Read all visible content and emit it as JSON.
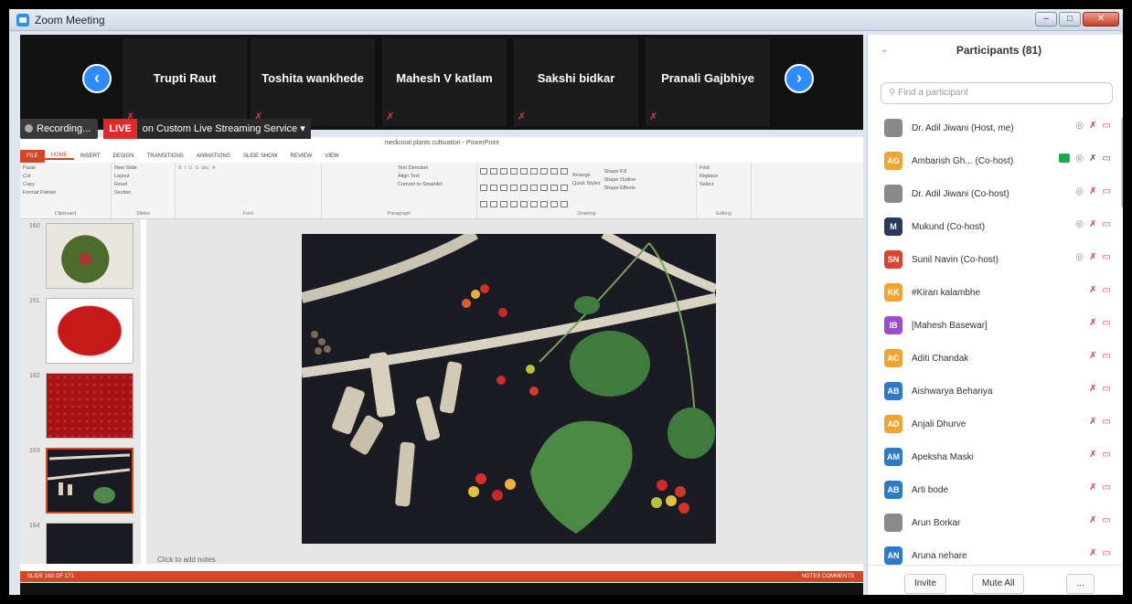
{
  "window": {
    "title": "Zoom Meeting",
    "min": "",
    "max": "",
    "close": ""
  },
  "strip": {
    "prev": "<",
    "next": ">",
    "participants": [
      "Trupti Raut",
      "Toshita wankhede",
      "Mahesh V katlam",
      "Sakshi bidkar",
      "Pranali Gajbhiye"
    ]
  },
  "recording": {
    "label": "Recording...",
    "live": "LIVE",
    "service": "on Custom Live Streaming Service"
  },
  "ppt": {
    "title": "medicinal plants cultivation - PowerPoint",
    "tabs": [
      "FILE",
      "HOME",
      "INSERT",
      "DESIGN",
      "TRANSITIONS",
      "ANIMATIONS",
      "SLIDE SHOW",
      "REVIEW",
      "VIEW"
    ],
    "ribbon": {
      "clipboard": {
        "paste": "Paste",
        "cut": "Cut",
        "copy": "Copy",
        "format": "Format Painter",
        "label": "Clipboard"
      },
      "slides": {
        "new": "New Slide",
        "layout": "Layout",
        "reset": "Reset",
        "section": "Section",
        "label": "Slides"
      },
      "font": {
        "label": "Font"
      },
      "paragraph": {
        "dir": "Text Direction",
        "align": "Align Text",
        "convert": "Convert to SmartArt",
        "label": "Paragraph"
      },
      "drawing": {
        "arrange": "Arrange",
        "quick": "Quick Styles",
        "fill": "Shape Fill",
        "outline": "Shape Outline",
        "effects": "Shape Effects",
        "label": "Drawing"
      },
      "editing": {
        "find": "Find",
        "replace": "Replace",
        "select": "Select",
        "label": "Editing"
      }
    },
    "slide_numbers": [
      "160",
      "161",
      "162",
      "163",
      "164"
    ],
    "notes_placeholder": "Click to add notes",
    "status_left": "SLIDE 163 OF 171",
    "status_right": "NOTES   COMMENTS"
  },
  "panel": {
    "title": "Participants (81)",
    "search_placeholder": "Find a participant",
    "participants": [
      {
        "initials": "",
        "name": "Dr. Adil Jiwani (Host, me)",
        "color": "#8a8a8a",
        "photo": true
      },
      {
        "initials": "AG",
        "name": "Ambarish Gh... (Co-host)",
        "color": "#f0a530",
        "photo": false
      },
      {
        "initials": "",
        "name": "Dr. Adil Jiwani (Co-host)",
        "color": "#8a8a8a",
        "photo": true
      },
      {
        "initials": "M",
        "name": "Mukund (Co-host)",
        "color": "#2b3a5a",
        "photo": false
      },
      {
        "initials": "SN",
        "name": "Sunil Navin (Co-host)",
        "color": "#d9432f",
        "photo": false
      },
      {
        "initials": "KK",
        "name": "#Kiran kalambhe",
        "color": "#f0a530",
        "photo": false
      },
      {
        "initials": "IB",
        "name": "[Mahesh Basewar]",
        "color": "#9b4dca",
        "photo": false
      },
      {
        "initials": "AC",
        "name": "Aditi Chandak",
        "color": "#f0a530",
        "photo": false
      },
      {
        "initials": "AB",
        "name": "Aishwarya Behariya",
        "color": "#2d7ac8",
        "photo": false
      },
      {
        "initials": "AD",
        "name": "Anjali Dhurve",
        "color": "#f0a530",
        "photo": false
      },
      {
        "initials": "AM",
        "name": "Apeksha Maski",
        "color": "#2d7ac8",
        "photo": false
      },
      {
        "initials": "AB",
        "name": "Arti bode",
        "color": "#2d7ac8",
        "photo": false
      },
      {
        "initials": "",
        "name": "Arun Borkar",
        "color": "#8a8a8a",
        "photo": true
      },
      {
        "initials": "AN",
        "name": "Aruna nehare",
        "color": "#2d7ac8",
        "photo": false
      }
    ],
    "invite": "Invite",
    "mute_all": "Mute All",
    "more": "..."
  }
}
